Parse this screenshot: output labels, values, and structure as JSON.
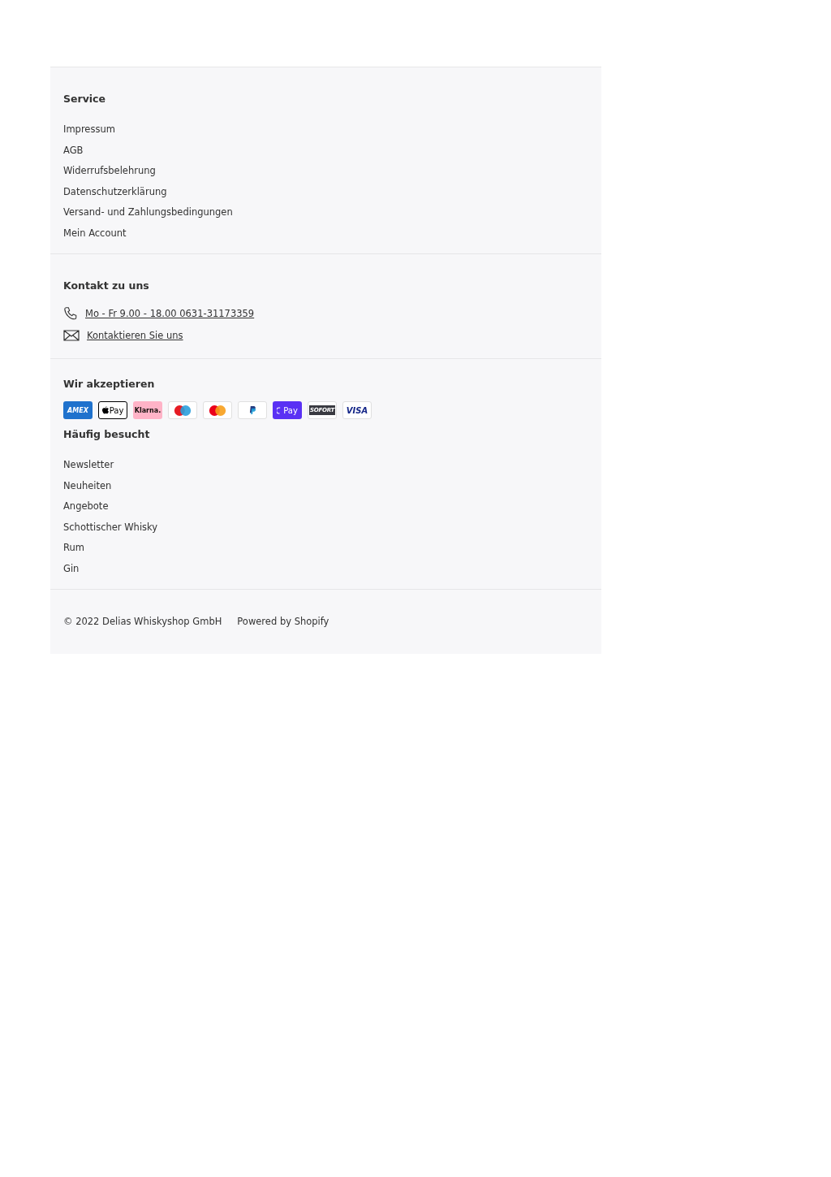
{
  "sections": [
    {
      "kind": "links",
      "title": "Service",
      "links": [
        "Impressum",
        "AGB",
        "Widerrufsbelehrung",
        "Datenschutzerklärung",
        "Versand- und Zahlungsbedingungen",
        "Mein Account"
      ]
    },
    {
      "kind": "contact",
      "title": "Kontakt zu uns",
      "contacts": [
        {
          "kind": "phone",
          "text": "Mo - Fr 9.00 - 18.00 0631-31173359"
        },
        {
          "kind": "mail",
          "text": "Kontaktieren Sie uns"
        }
      ]
    },
    {
      "kind": "payments",
      "title": "Wir akzeptieren",
      "methods": [
        {
          "kind": "amex",
          "label": "AMEX"
        },
        {
          "kind": "applepay",
          "label": "Pay"
        },
        {
          "kind": "klarna",
          "label": "Klarna."
        },
        {
          "kind": "maestro"
        },
        {
          "kind": "mastercard"
        },
        {
          "kind": "paypal"
        },
        {
          "kind": "shoppay",
          "label": "Pay"
        },
        {
          "kind": "sofort",
          "label": "SOFORT"
        },
        {
          "kind": "visa",
          "label": "VISA"
        }
      ]
    },
    {
      "kind": "links",
      "title": "Häufig besucht",
      "links": [
        "Newsletter",
        "Neuheiten",
        "Angebote",
        "Schottischer Whisky",
        "Rum",
        "Gin"
      ]
    }
  ],
  "footer": {
    "copyright": "© 2022 Delias Whiskyshop GmbH",
    "powered": "Powered by Shopify"
  }
}
